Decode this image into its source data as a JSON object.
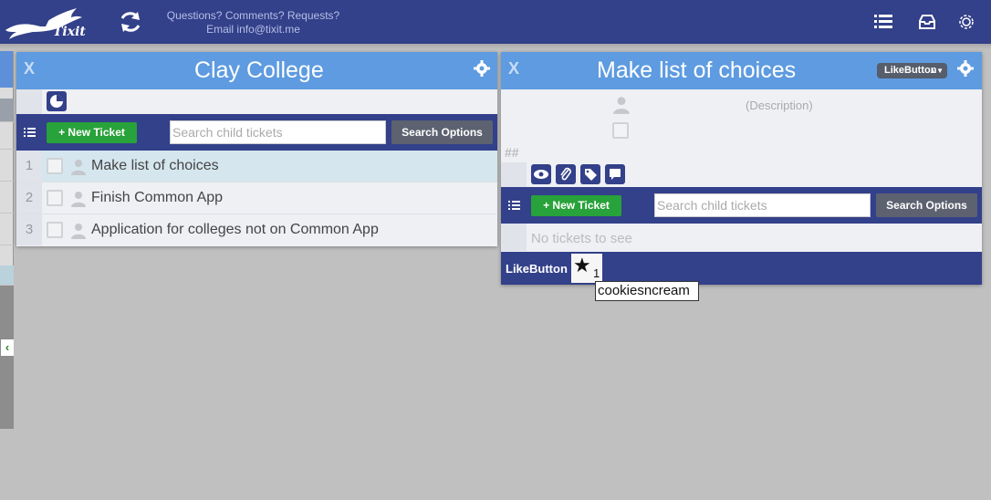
{
  "topbar": {
    "logo_text": "Tixit",
    "contact_line1": "Questions? Comments? Requests?",
    "contact_line2": "Email info@tixit.me"
  },
  "left_card": {
    "close_label": "X",
    "title": "Clay College",
    "new_ticket_label": "+ New Ticket",
    "search_placeholder": "Search child tickets",
    "search_options_label": "Search Options",
    "rows": [
      {
        "num": "1",
        "text": "Make list of choices"
      },
      {
        "num": "2",
        "text": "Finish Common App"
      },
      {
        "num": "3",
        "text": "Application for colleges not on Common App"
      }
    ]
  },
  "right_card": {
    "close_label": "X",
    "title": "Make list of choices",
    "dropdown_label": "LikeButton",
    "description_placeholder": "(Description)",
    "number_placeholder": "##",
    "new_ticket_label": "+ New Ticket",
    "search_placeholder": "Search child tickets",
    "search_options_label": "Search Options",
    "empty_text": "No tickets to see",
    "like_label": "LikeButton",
    "like_count": "1",
    "tooltip": "cookiesncream"
  },
  "colors": {
    "nav": "#33408a",
    "card_header": "#5e9be0",
    "new_ticket": "#28a23a"
  }
}
